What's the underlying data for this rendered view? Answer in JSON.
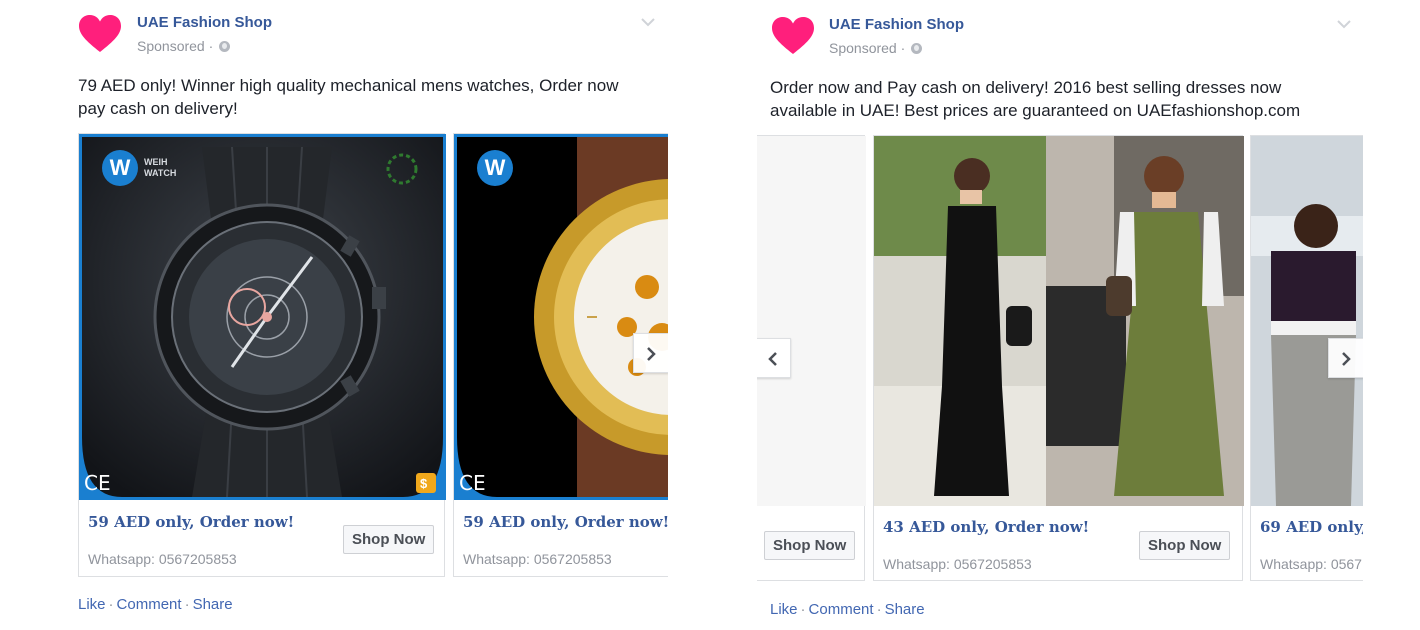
{
  "posts": [
    {
      "page_name": "UAE Fashion Shop",
      "sponsored": "Sponsored",
      "message_line1": "79 AED only! Winner high quality mechanical mens watches, Order now",
      "message_line2": "pay cash on delivery!",
      "cards": [
        {
          "headline": "59 AED only, Order now!",
          "subtext": "Whatsapp: 0567205853",
          "button": "Shop Now",
          "brand_logo": "W",
          "brand_text": "WEIH WATCH"
        },
        {
          "headline": "59 AED only, Order now!",
          "subtext": "Whatsapp: 0567205853",
          "brand_logo": "W"
        }
      ],
      "actions": {
        "like": "Like",
        "comment": "Comment",
        "share": "Share"
      }
    },
    {
      "page_name": "UAE Fashion Shop",
      "sponsored": "Sponsored",
      "message_line1": "Order now and Pay cash on delivery! 2016 best selling dresses now",
      "message_line2": "available in UAE! Best prices are guaranteed on UAEfashionshop.com",
      "cards": [
        {
          "button": "Shop Now"
        },
        {
          "headline": "43 AED only, Order now!",
          "subtext": "Whatsapp: 0567205853",
          "button": "Shop Now"
        },
        {
          "headline": "69 AED only,",
          "subtext": "Whatsapp: 0567"
        }
      ],
      "actions": {
        "like": "Like",
        "comment": "Comment",
        "share": "Share"
      }
    }
  ],
  "icons": {
    "avatar": "heart-icon",
    "options": "chevron-down-icon",
    "privacy": "globe-icon",
    "next": "chevron-right-icon",
    "prev": "chevron-left-icon",
    "certification": "ce-mark-icon",
    "badge": "shopping-bag-icon"
  },
  "colors": {
    "link": "#365899",
    "heart": "#ff1f7c",
    "card_border_selected": "#1a7fd0",
    "meta_text": "#90949c"
  }
}
